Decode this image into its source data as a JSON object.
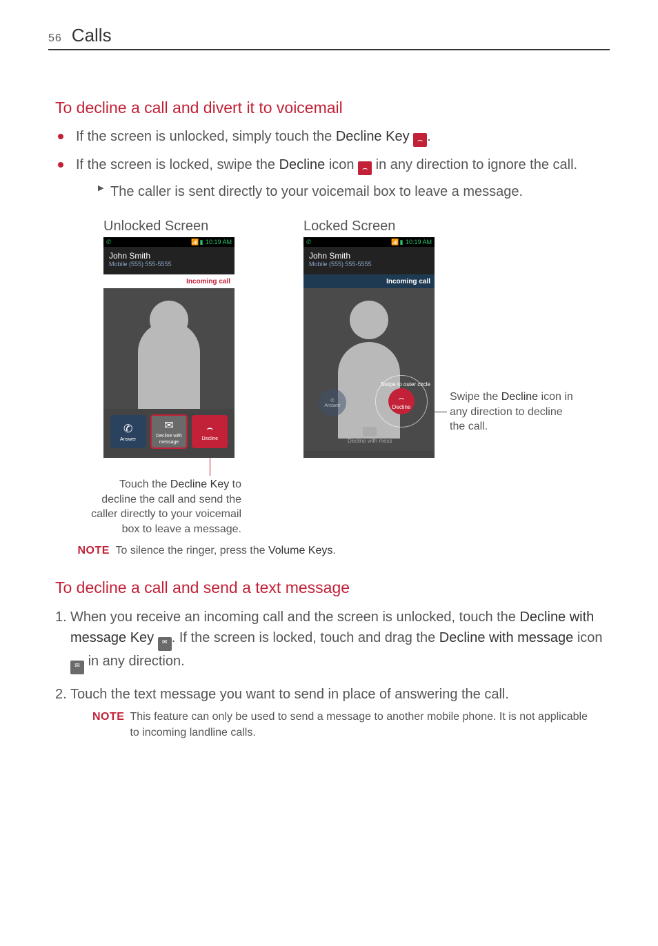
{
  "page_number": "56",
  "header_title": "Calls",
  "section1": {
    "title": "To decline a call and divert it to voicemail",
    "bullet1_pre": "If the screen is unlocked, simply touch the ",
    "bullet1_key": "Decline Key",
    "bullet1_post": ".",
    "bullet2_pre": "If the screen is locked, swipe the ",
    "bullet2_key": "Decline",
    "bullet2_mid": " icon ",
    "bullet2_post": " in any direction to ignore the call.",
    "sub1": "The caller is sent directly to your voicemail box to leave a message."
  },
  "figures": {
    "unlocked_label": "Unlocked Screen",
    "locked_label": "Locked Screen",
    "status_time": "10:19 AM",
    "caller_name": "John Smith",
    "caller_line_pre": "Mobile",
    "caller_line_num": "(555) 555-5555",
    "incoming": "Incoming call",
    "btn_answer": "Answer",
    "btn_msg_l1": "Decline with",
    "btn_msg_l2": "message",
    "btn_decline": "Decline",
    "swipe_hint": "Swipe to outer circle",
    "msg_faint": "Decline with mess",
    "unlocked_caption_1": "Touch the ",
    "unlocked_caption_key": "Decline Key",
    "unlocked_caption_2": " to decline the call and send the caller directly to your voicemail box to leave a message.",
    "locked_caption_1": "Swipe the ",
    "locked_caption_key": "Decline",
    "locked_caption_2": " icon in any direction to decline the call."
  },
  "note1": {
    "label": "NOTE",
    "text_pre": "To silence the ringer, press the ",
    "text_key": "Volume Keys",
    "text_post": "."
  },
  "section2": {
    "title": "To decline a call and send a text message",
    "step1_pre": "When you receive an incoming call and the screen is unlocked, touch the ",
    "step1_key1": "Decline with message Key",
    "step1_mid": ". If the screen is locked, touch and drag the ",
    "step1_key2": "Decline with message",
    "step1_mid2": " icon ",
    "step1_post": " in any direction.",
    "step2": "Touch the text message you want to send in place of answering the call."
  },
  "note2": {
    "label": "NOTE",
    "text": "This feature can only be used to send a message to another mobile phone. It is not applicable to incoming landline calls."
  },
  "glyphs": {
    "phone_down": "⌢",
    "phone": "✆",
    "msg": "✉"
  }
}
